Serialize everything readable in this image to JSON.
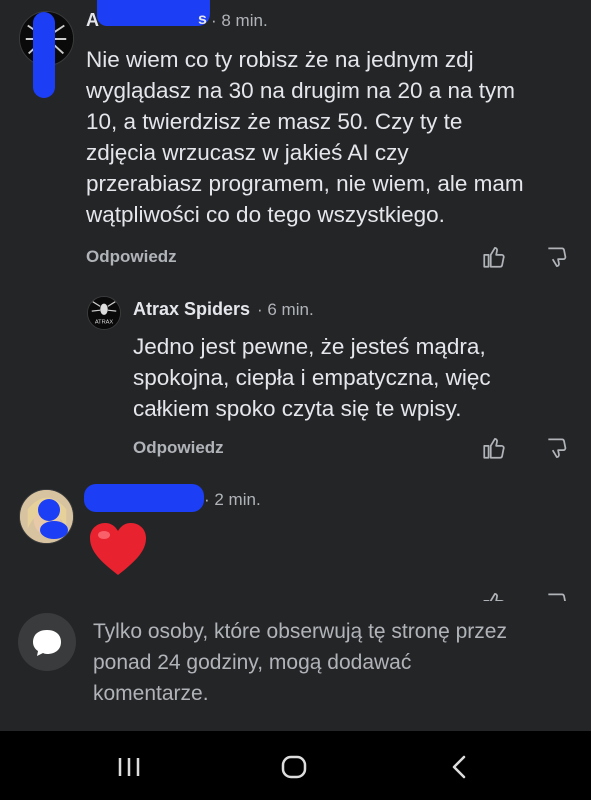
{
  "comments": [
    {
      "author_visible": "A",
      "author_tail": "s",
      "time": "· 8 min.",
      "text": "Nie wiem co ty robisz że na jednym zdj\nwyglądasz na 30 na drugim na 20 a na tym\n10, a twierdzisz że masz 50. Czy ty te\nzdjęcia wrzucasz w jakieś AI czy\nprzerabiasz programem, nie wiem, ale mam\nwątpliwości co do tego wszystkiego.",
      "reply_label": "Odpowiedz"
    },
    {
      "author": "Atrax Spiders",
      "time": "· 6 min.",
      "avatar_text": "ATRAX",
      "text": "Jedno jest pewne, że jesteś mądra,\nspokojna, ciepła i empatyczna, więc\ncałkiem spoko czyta się te wpisy.",
      "reply_label": "Odpowiedz"
    },
    {
      "time": "· 2 min.",
      "emoji": "❤️"
    }
  ],
  "footer": {
    "notice": "Tylko osoby, które obserwują tę stronę przez\nponad 24 godziny, mogą dodawać\nkomentarze."
  },
  "colors": {
    "background": "#242527",
    "text": "#e4e6eb",
    "muted": "#b0b3b8",
    "redaction": "#1c3ff5"
  },
  "icons": {
    "like": "thumbs-up-icon",
    "dislike": "thumbs-down-icon",
    "notice": "comment-bubble-icon",
    "nav": [
      "recent-apps-icon",
      "home-icon",
      "back-icon"
    ]
  }
}
